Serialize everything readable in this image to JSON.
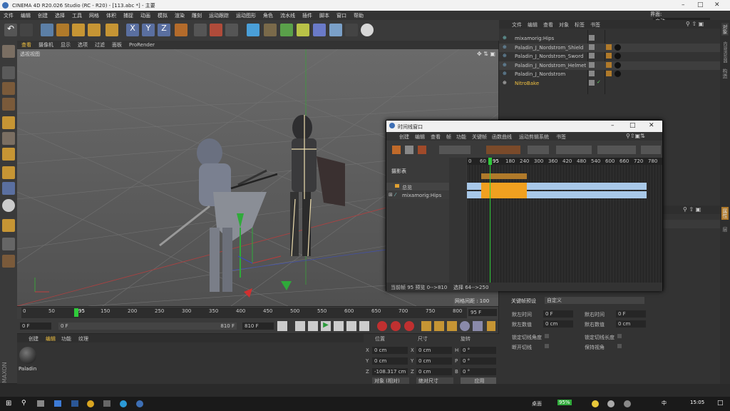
{
  "window": {
    "title": "CINEMA 4D R20.026 Studio (RC - R20) - [113.abc *] - 主要"
  },
  "menubar": [
    "文件",
    "编辑",
    "创建",
    "选择",
    "工具",
    "网格",
    "体积",
    "捕捉",
    "动画",
    "模拟",
    "渲染",
    "雕刻",
    "运动跟踪",
    "运动图形",
    "角色",
    "流水线",
    "插件",
    "脚本",
    "窗口",
    "帮助"
  ],
  "layout": {
    "label": "界面:",
    "value": "启动"
  },
  "viewport": {
    "menu": [
      "查看",
      "摄像机",
      "显示",
      "选项",
      "过滤",
      "面板",
      "ProRender"
    ],
    "camera_label": "透视视图",
    "grid_spacing": "网格间距 : 100 cm"
  },
  "timeline": {
    "ticks": [
      "0",
      "50",
      "95",
      "150",
      "200",
      "250",
      "300",
      "350",
      "400",
      "450",
      "500",
      "550",
      "600",
      "650",
      "700",
      "750",
      "800"
    ],
    "current_frame": "95 F"
  },
  "transport": {
    "start": "0 F",
    "min": "0 F",
    "max": "810 F",
    "end": "810 F"
  },
  "materials": {
    "menu": [
      "创建",
      "编辑",
      "功能",
      "纹理"
    ],
    "item": "Paladin"
  },
  "coords": {
    "headers": [
      "位置",
      "尺寸",
      "旋转"
    ],
    "rows": [
      {
        "axis": "X",
        "pos": "0 cm",
        "size_axis": "X",
        "size": "0 cm",
        "rot_axis": "H",
        "rot": "0 °"
      },
      {
        "axis": "Y",
        "pos": "0 cm",
        "size_axis": "Y",
        "size": "0 cm",
        "rot_axis": "P",
        "rot": "0 °"
      },
      {
        "axis": "Z",
        "pos": "-108.317 cm",
        "size_axis": "Z",
        "size": "0 cm",
        "rot_axis": "B",
        "rot": "0 °"
      }
    ],
    "mode1": "对象 (相对)",
    "mode2": "绝对尺寸",
    "apply": "应用"
  },
  "objects": {
    "menu": [
      "文件",
      "编辑",
      "查看",
      "对象",
      "标签",
      "书签"
    ],
    "items": [
      "mixamorig:Hips",
      "Paladin_J_Nordstrom_Shield",
      "Paladin_J_Nordstrom_Sword",
      "Paladin_J_Nordstrom_Helmet",
      "Paladin_J_Nordstrom",
      "NitroBake"
    ]
  },
  "rightside": {
    "tabs": [
      "对象",
      "内容浏览器",
      "构造",
      "属性",
      "层"
    ]
  },
  "attributes": {
    "preset_label": "关键帧预设",
    "preset_value": "自定义",
    "left_time_label": "默左时间",
    "left_time": "0 F",
    "right_time_label": "默右时间",
    "right_time": "0 F",
    "left_value_label": "默左数值",
    "left_value": "0 cm",
    "right_value_label": "默右数值",
    "right_value": "0 cm",
    "lock_angle": "锁定切线角度",
    "lock_length": "锁定切线长度",
    "break_tangent": "断开切线",
    "keep_angle": "保持视角"
  },
  "timeline_window": {
    "title": "时间线窗口",
    "menu": [
      "创建",
      "编辑",
      "查看",
      "帧",
      "功能",
      "关键帧",
      "函数曲线",
      "运动剪辑系统",
      "书签"
    ],
    "ruler": [
      "0",
      "60",
      "95",
      "180",
      "240",
      "300",
      "360",
      "420",
      "480",
      "540",
      "600",
      "660",
      "720",
      "780"
    ],
    "rows": [
      {
        "label": "摄影表"
      },
      {
        "label": "总览"
      },
      {
        "label": "mixamorig:Hips"
      }
    ],
    "status_left": "当前帧 95  预览 0-->810",
    "status_right": "选择 64-->250"
  },
  "taskbar": {
    "battery": "95%",
    "ime": "中",
    "time": "15:05",
    "desktop": "桌面"
  }
}
